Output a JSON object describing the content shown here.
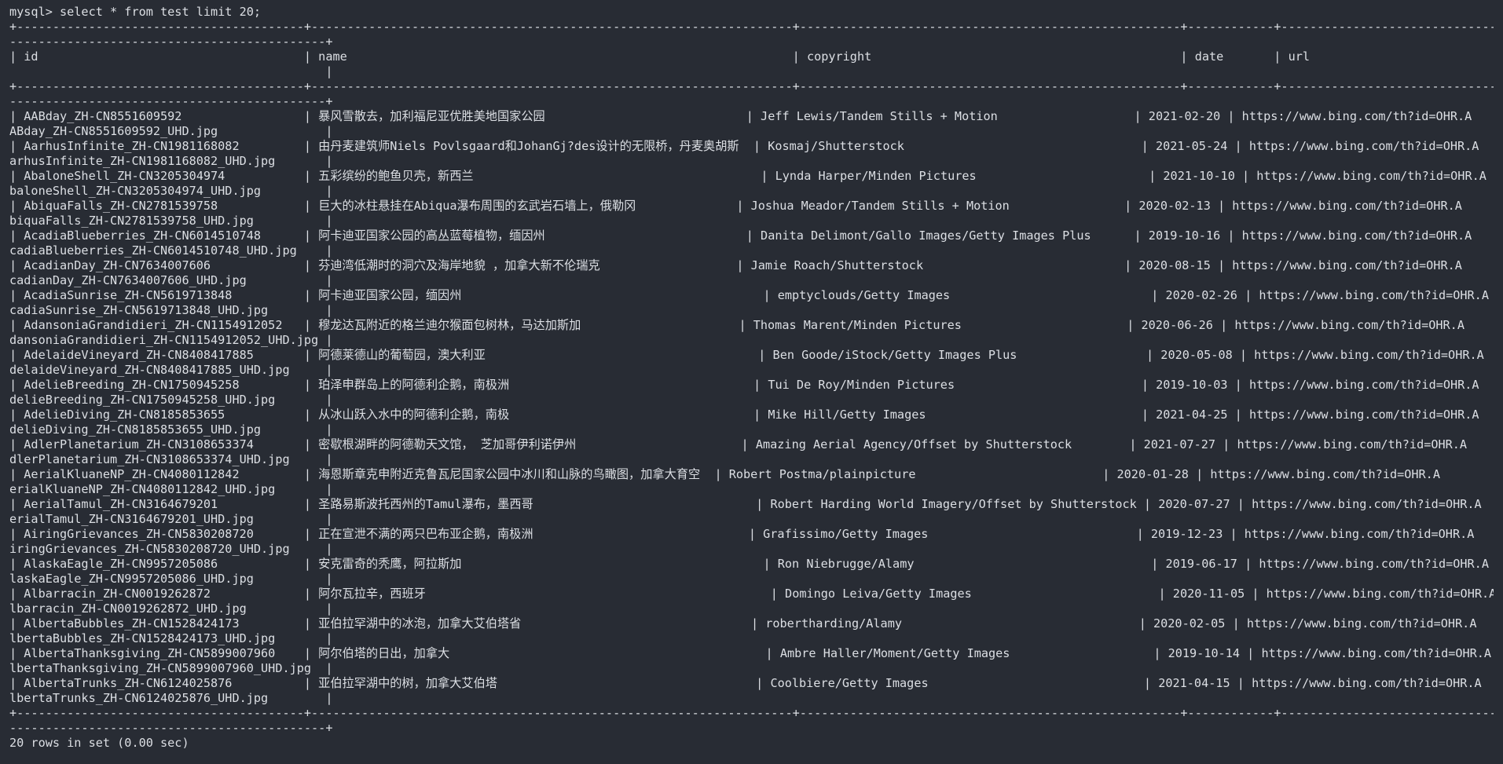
{
  "prompt": "mysql> ",
  "command": "select * from test limit 20;",
  "footer": "20 rows in set (0.00 sec)",
  "lines": [
    "mysql> select * from test limit 20;",
    "+----------------------------------------+-------------------------------------------------------------------+-----------------------------------------------------+------------+-----------------------------------",
    "--------------------------------------------+",
    "| id                                     | name                                                              | copyright                                           | date       | url",
    "                                            |",
    "+----------------------------------------+-------------------------------------------------------------------+-----------------------------------------------------+------------+-----------------------------------",
    "--------------------------------------------+",
    "| AABday_ZH-CN8551609592                 | 暴风雪散去，加利福尼亚优胜美地国家公园                            | Jeff Lewis/Tandem Stills + Motion                   | 2021-02-20 | https://www.bing.com/th?id=OHR.A",
    "ABday_ZH-CN8551609592_UHD.jpg               |",
    "| AarhusInfinite_ZH-CN1981168082         | 由丹麦建筑师Niels Povlsgaard和JohanGj?des设计的无限桥，丹麦奥胡斯  | Kosmaj/Shutterstock                                 | 2021-05-24 | https://www.bing.com/th?id=OHR.A",
    "arhusInfinite_ZH-CN1981168082_UHD.jpg       |",
    "| AbaloneShell_ZH-CN3205304974           | 五彩缤纷的鲍鱼贝壳，新西兰                                        | Lynda Harper/Minden Pictures                        | 2021-10-10 | https://www.bing.com/th?id=OHR.A",
    "baloneShell_ZH-CN3205304974_UHD.jpg         |",
    "| AbiquaFalls_ZH-CN2781539758            | 巨大的冰柱悬挂在Abiqua瀑布周围的玄武岩石墙上，俄勒冈              | Joshua Meador/Tandem Stills + Motion                | 2020-02-13 | https://www.bing.com/th?id=OHR.A",
    "biquaFalls_ZH-CN2781539758_UHD.jpg          |",
    "| AcadiaBlueberries_ZH-CN6014510748      | 阿卡迪亚国家公园的高丛蓝莓植物，缅因州                            | Danita Delimont/Gallo Images/Getty Images Plus      | 2019-10-16 | https://www.bing.com/th?id=OHR.A",
    "cadiaBlueberries_ZH-CN6014510748_UHD.jpg    |",
    "| AcadianDay_ZH-CN7634007606             | 芬迪湾低潮时的洞穴及海岸地貌 ，加拿大新不伦瑞克                   | Jamie Roach/Shutterstock                            | 2020-08-15 | https://www.bing.com/th?id=OHR.A",
    "cadianDay_ZH-CN7634007606_UHD.jpg           |",
    "| AcadiaSunrise_ZH-CN5619713848          | 阿卡迪亚国家公园，缅因州                                          | emptyclouds/Getty Images                            | 2020-02-26 | https://www.bing.com/th?id=OHR.A",
    "cadiaSunrise_ZH-CN5619713848_UHD.jpg        |",
    "| AdansoniaGrandidieri_ZH-CN1154912052   | 穆龙达瓦附近的格兰迪尔猴面包树林，马达加斯加                      | Thomas Marent/Minden Pictures                       | 2020-06-26 | https://www.bing.com/th?id=OHR.A",
    "dansoniaGrandidieri_ZH-CN1154912052_UHD.jpg |",
    "| AdelaideVineyard_ZH-CN8408417885       | 阿德莱德山的葡萄园，澳大利亚                                      | Ben Goode/iStock/Getty Images Plus                  | 2020-05-08 | https://www.bing.com/th?id=OHR.A",
    "delaideVineyard_ZH-CN8408417885_UHD.jpg     |",
    "| AdelieBreeding_ZH-CN1750945258         | 珀泽申群岛上的阿德利企鹅，南极洲                                  | Tui De Roy/Minden Pictures                          | 2019-10-03 | https://www.bing.com/th?id=OHR.A",
    "delieBreeding_ZH-CN1750945258_UHD.jpg       |",
    "| AdelieDiving_ZH-CN8185853655           | 从冰山跃入水中的阿德利企鹅，南极                                  | Mike Hill/Getty Images                              | 2021-04-25 | https://www.bing.com/th?id=OHR.A",
    "delieDiving_ZH-CN8185853655_UHD.jpg         |",
    "| AdlerPlanetarium_ZH-CN3108653374       | 密歇根湖畔的阿德勒天文馆， 芝加哥伊利诺伊州                       | Amazing Aerial Agency/Offset by Shutterstock        | 2021-07-27 | https://www.bing.com/th?id=OHR.A",
    "dlerPlanetarium_ZH-CN3108653374_UHD.jpg     |",
    "| AerialKluaneNP_ZH-CN4080112842         | 海恩斯章克申附近克鲁瓦尼国家公园中冰川和山脉的鸟瞰图，加拿大育空  | Robert Postma/plainpicture                          | 2020-01-28 | https://www.bing.com/th?id=OHR.A",
    "erialKluaneNP_ZH-CN4080112842_UHD.jpg       |",
    "| AerialTamul_ZH-CN3164679201            | 圣路易斯波托西州的Tamul瀑布，墨西哥                               | Robert Harding World Imagery/Offset by Shutterstock | 2020-07-27 | https://www.bing.com/th?id=OHR.A",
    "erialTamul_ZH-CN3164679201_UHD.jpg          |",
    "| AiringGrievances_ZH-CN5830208720       | 正在宣泄不满的两只巴布亚企鹅，南极洲                              | Grafissimo/Getty Images                             | 2019-12-23 | https://www.bing.com/th?id=OHR.A",
    "iringGrievances_ZH-CN5830208720_UHD.jpg     |",
    "| AlaskaEagle_ZH-CN9957205086            | 安克雷奇的秃鹰，阿拉斯加                                          | Ron Niebrugge/Alamy                                 | 2019-06-17 | https://www.bing.com/th?id=OHR.A",
    "laskaEagle_ZH-CN9957205086_UHD.jpg          |",
    "| Albarracin_ZH-CN0019262872             | 阿尔瓦拉辛，西班牙                                                | Domingo Leiva/Getty Images                          | 2020-11-05 | https://www.bing.com/th?id=OHR.A",
    "lbarracin_ZH-CN0019262872_UHD.jpg           |",
    "| AlbertaBubbles_ZH-CN1528424173         | 亚伯拉罕湖中的冰泡，加拿大艾伯塔省                                | robertharding/Alamy                                 | 2020-02-05 | https://www.bing.com/th?id=OHR.A",
    "lbertaBubbles_ZH-CN1528424173_UHD.jpg       |",
    "| AlbertaThanksgiving_ZH-CN5899007960    | 阿尔伯塔的日出，加拿大                                            | Ambre Haller/Moment/Getty Images                    | 2019-10-14 | https://www.bing.com/th?id=OHR.A",
    "lbertaThanksgiving_ZH-CN5899007960_UHD.jpg  |",
    "| AlbertaTrunks_ZH-CN6124025876          | 亚伯拉罕湖中的树，加拿大艾伯塔                                    | Coolbiere/Getty Images                              | 2021-04-15 | https://www.bing.com/th?id=OHR.A",
    "lbertaTrunks_ZH-CN6124025876_UHD.jpg        |",
    "+----------------------------------------+-------------------------------------------------------------------+-----------------------------------------------------+------------+-----------------------------------",
    "--------------------------------------------+",
    "20 rows in set (0.00 sec)"
  ]
}
